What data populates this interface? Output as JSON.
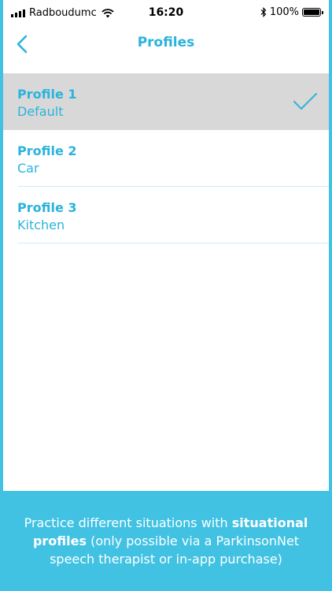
{
  "status_bar": {
    "carrier": "Radboudumc",
    "time": "16:20",
    "battery_text": "100%",
    "battery_level": 1.0
  },
  "nav": {
    "title": "Profiles",
    "back_icon": "chevron-left-icon"
  },
  "profiles": [
    {
      "title": "Profile 1",
      "subtitle": "Default",
      "selected": true
    },
    {
      "title": "Profile 2",
      "subtitle": "Car",
      "selected": false
    },
    {
      "title": "Profile 3",
      "subtitle": "Kitchen",
      "selected": false
    }
  ],
  "caption": {
    "part1": "Practice different situations with ",
    "bold": "situational profiles",
    "part2": " (only possible via a ParkinsonNet speech therapist or in-app purchase)"
  },
  "colors": {
    "accent": "#2bb3dc",
    "background": "#41c2e3",
    "selected_row": "#d8d8d8"
  }
}
